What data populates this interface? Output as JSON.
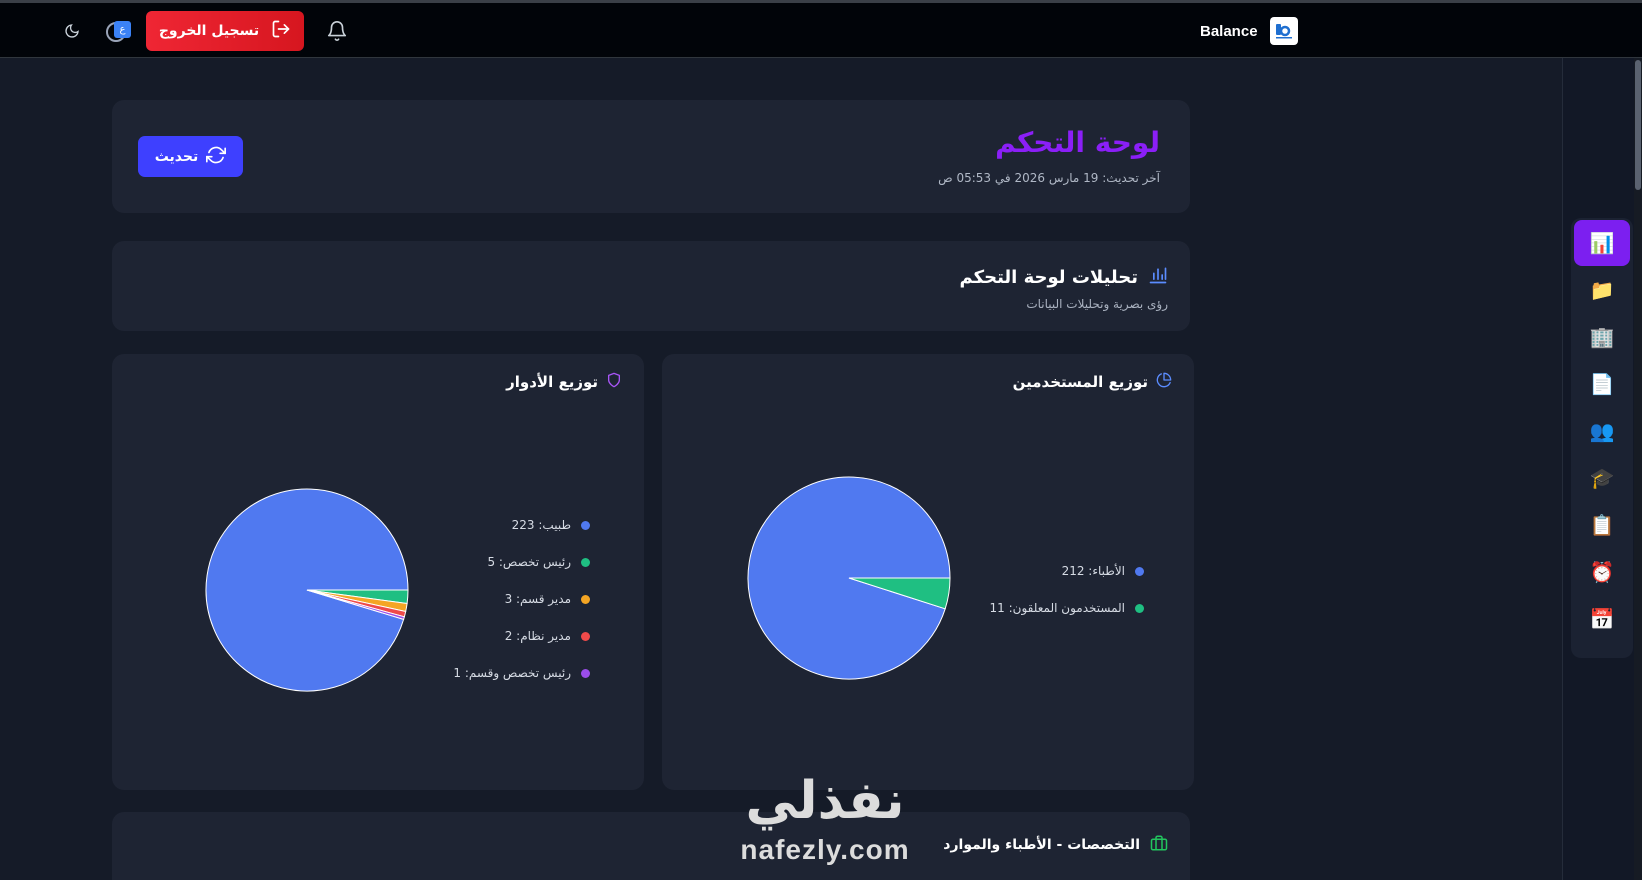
{
  "topbar": {
    "brand_name": "Balance",
    "logout_label": "تسجيل الخروج",
    "lang_badge": "ع"
  },
  "sidebar": {
    "items": [
      {
        "icon": "bar-chart-icon",
        "glyph": "📊",
        "active": true
      },
      {
        "icon": "folder-icon",
        "glyph": "📁",
        "active": false
      },
      {
        "icon": "building-icon",
        "glyph": "🏢",
        "active": false
      },
      {
        "icon": "document-icon",
        "glyph": "📄",
        "active": false
      },
      {
        "icon": "users-icon",
        "glyph": "👥",
        "active": false
      },
      {
        "icon": "graduation-cap-icon",
        "glyph": "🎓",
        "active": false
      },
      {
        "icon": "clipboard-icon",
        "glyph": "📋",
        "active": false
      },
      {
        "icon": "alarm-clock-icon",
        "glyph": "⏰",
        "active": false
      },
      {
        "icon": "calendar-icon",
        "glyph": "📅",
        "active": false
      }
    ]
  },
  "header": {
    "title": "لوحة التحكم",
    "last_updated": "آخر تحديث: 19 مارس 2026 في 05:53 ص",
    "refresh_label": "تحديث"
  },
  "analytics": {
    "title": "تحليلات لوحة التحكم",
    "subtitle": "رؤى بصرية وتحليلات البيانات"
  },
  "user_distribution": {
    "title": "توزيع المستخدمين",
    "legend": [
      "الأطباء: 212",
      "المستخدمون المعلقون: 11"
    ]
  },
  "role_distribution": {
    "title": "توزيع الأدوار",
    "legend": [
      "طبيب: 223",
      "رئيس تخصص: 5",
      "مدير قسم: 3",
      "مدير نظام: 2",
      "رئيس تخصص وقسم: 1"
    ]
  },
  "specialties": {
    "title": "التخصصات - الأطباء والموارد"
  },
  "watermark": {
    "arabic": "نفذلي",
    "latin": "nafezly.com"
  },
  "colors": {
    "blue": "#5079f0",
    "green": "#1fbf82",
    "orange": "#f4a524",
    "red": "#ef4a4a",
    "purple": "#9b4dea",
    "accent_purple": "#8b1ff7"
  },
  "chart_data": [
    {
      "type": "pie",
      "title": "توزيع المستخدمين",
      "categories": [
        "الأطباء",
        "المستخدمون المعلقون"
      ],
      "values": [
        212,
        11
      ],
      "colors": [
        "#5079f0",
        "#1fbf82"
      ],
      "legend_position": "right"
    },
    {
      "type": "pie",
      "title": "توزيع الأدوار",
      "categories": [
        "طبيب",
        "رئيس تخصص",
        "مدير قسم",
        "مدير نظام",
        "رئيس تخصص وقسم"
      ],
      "values": [
        223,
        5,
        3,
        2,
        1
      ],
      "colors": [
        "#5079f0",
        "#1fbf82",
        "#f4a524",
        "#ef4a4a",
        "#9b4dea"
      ],
      "legend_position": "right"
    }
  ]
}
